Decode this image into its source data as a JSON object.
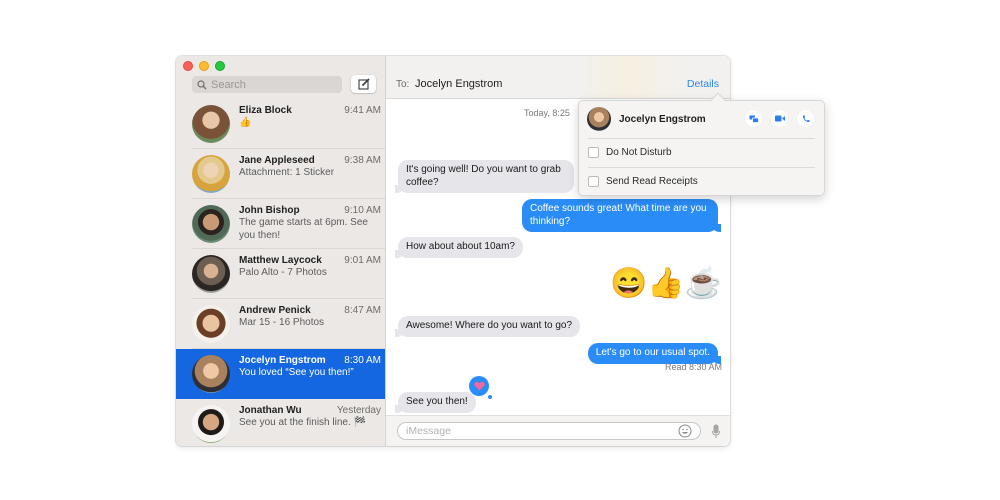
{
  "sidebar": {
    "search_placeholder": "Search",
    "conversations": [
      {
        "name": "Eliza Block",
        "time": "9:41 AM",
        "preview": "👍",
        "avatar_color": "#8b6a4f"
      },
      {
        "name": "Jane Appleseed",
        "time": "9:38 AM",
        "preview": "Attachment: 1 Sticker",
        "avatar_color": "#d2a866"
      },
      {
        "name": "John Bishop",
        "time": "9:10 AM",
        "preview": "The game starts at 6pm. See you then!",
        "avatar_color": "#5b4b3c"
      },
      {
        "name": "Matthew Laycock",
        "time": "9:01 AM",
        "preview": "Palo Alto - 7 Photos",
        "avatar_color": "#7a746c"
      },
      {
        "name": "Andrew Penick",
        "time": "8:47 AM",
        "preview": "Mar 15 - 16 Photos",
        "avatar_color": "#b7805a"
      },
      {
        "name": "Jocelyn Engstrom",
        "time": "8:30 AM",
        "preview": "You loved “See you then!”",
        "avatar_color": "#a07b5c",
        "selected": true
      },
      {
        "name": "Jonathan Wu",
        "time": "Yesterday",
        "preview": "See you at the finish line. 🏁",
        "avatar_color": "#6b4d3b"
      }
    ]
  },
  "header": {
    "to_label": "To:",
    "recipient": "Jocelyn Engstrom",
    "details_label": "Details"
  },
  "chat": {
    "timestamp": "Today, 8:25",
    "messages": [
      {
        "direction": "in",
        "text": "It's going well! Do you want to grab coffee?"
      },
      {
        "direction": "out",
        "text": "Coffee sounds great! What time are you thinking?"
      },
      {
        "direction": "in",
        "text": "How about about 10am?"
      },
      {
        "direction": "out",
        "text": "😄👍☕"
      },
      {
        "direction": "in",
        "text": "Awesome! Where do you want to go?"
      },
      {
        "direction": "out",
        "text": "Let's go to our usual spot."
      },
      {
        "direction": "in",
        "text": "See you then!",
        "tapback": "heart"
      }
    ],
    "read_receipt": "Read 8:30 AM",
    "input_placeholder": "iMessage"
  },
  "popover": {
    "contact_name": "Jocelyn Engstrom",
    "actions": [
      "screen-share",
      "video-call",
      "phone-call"
    ],
    "options": [
      {
        "label": "Do Not Disturb",
        "checked": false
      },
      {
        "label": "Send Read Receipts",
        "checked": false
      }
    ]
  },
  "colors": {
    "accent": "#2a8cf6",
    "selected_row": "#1467e0",
    "tapback_heart": "#f2679b"
  }
}
